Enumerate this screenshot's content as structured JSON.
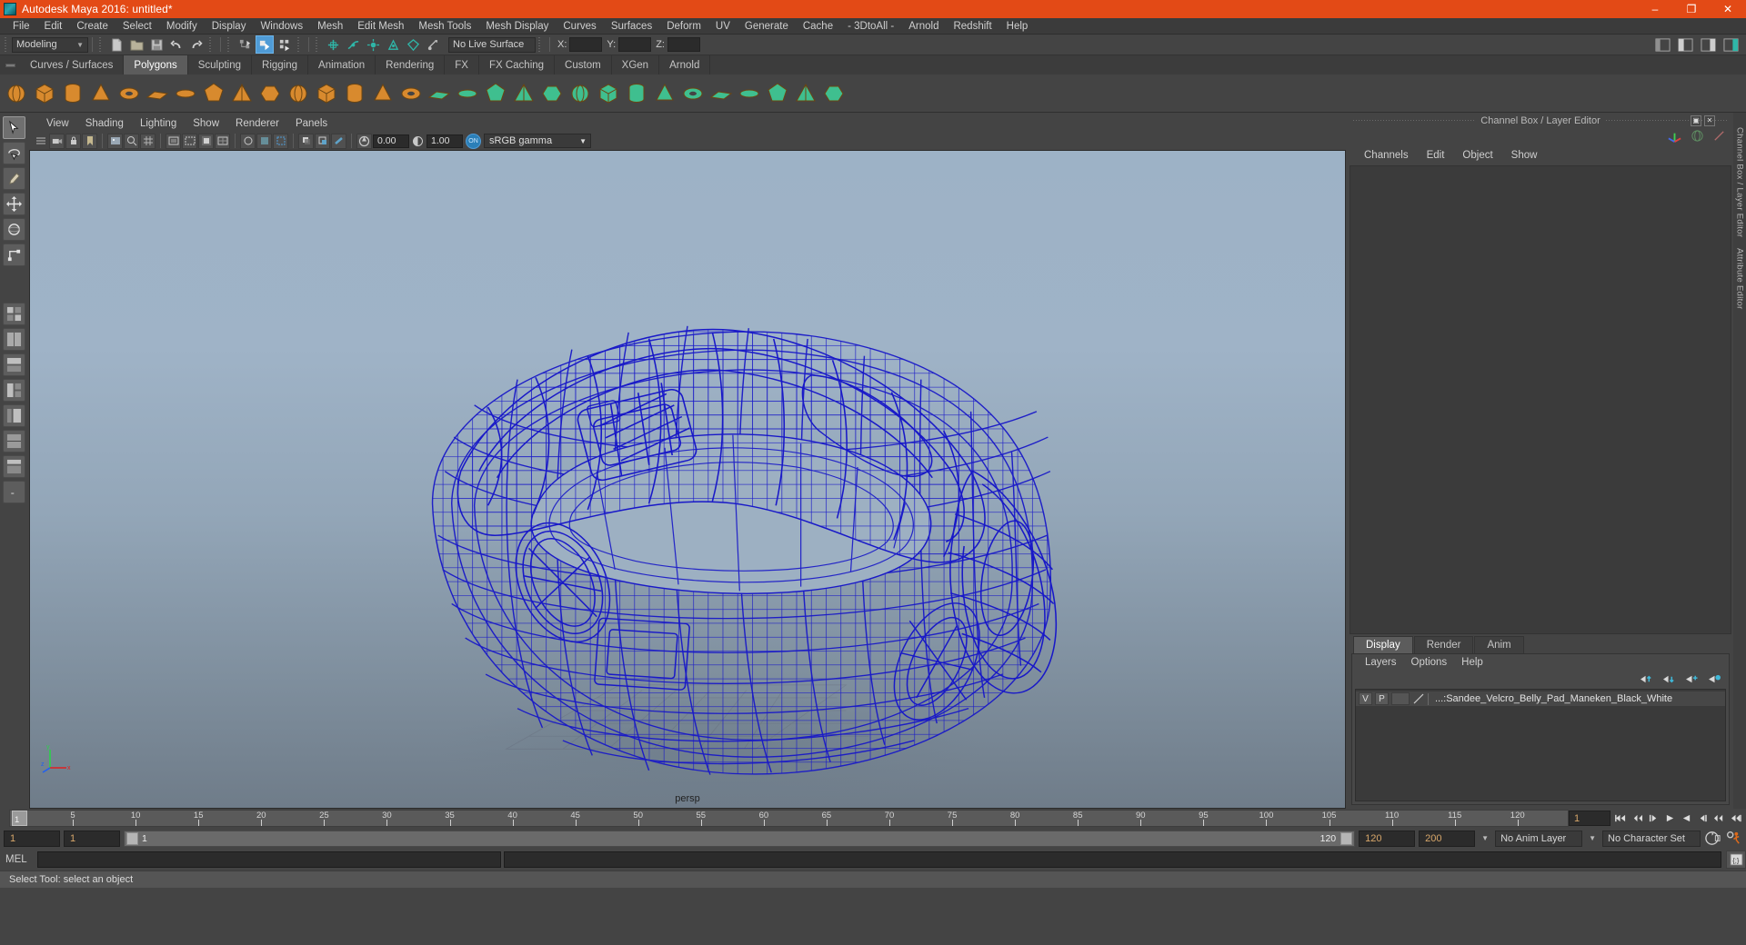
{
  "window": {
    "title": "Autodesk Maya 2016: untitled*",
    "logo_icon": "maya-logo-icon",
    "minimize": "–",
    "maximize": "❐",
    "close": "✕"
  },
  "menubar": {
    "items": [
      "File",
      "Edit",
      "Create",
      "Select",
      "Modify",
      "Display",
      "Windows",
      "Mesh",
      "Edit Mesh",
      "Mesh Tools",
      "Mesh Display",
      "Curves",
      "Surfaces",
      "Deform",
      "UV",
      "Generate",
      "Cache",
      "- 3DtoAll -",
      "Arnold",
      "Redshift",
      "Help"
    ]
  },
  "statusline": {
    "menuset": "Modeling",
    "live_surface": "No Live Surface",
    "coord_labels": [
      "X:",
      "Y:",
      "Z:"
    ],
    "coord_values": [
      "",
      "",
      ""
    ],
    "icons": [
      "new-scene-icon",
      "open-scene-icon",
      "save-scene-icon",
      "undo-icon",
      "redo-icon",
      "select-by-hierarchy-icon",
      "select-by-object-icon",
      "select-by-component-icon",
      "snap-to-grid-icon",
      "snap-to-curve-icon",
      "snap-to-point-icon",
      "snap-to-projected-center-icon",
      "snap-to-view-plane-icon",
      "make-live-icon",
      "show-hide-editors-icon",
      "attribute-editor-toggle-icon",
      "tool-settings-toggle-icon",
      "channel-box-toggle-icon"
    ]
  },
  "shelf": {
    "tabs": [
      "Curves / Surfaces",
      "Polygons",
      "Sculpting",
      "Rigging",
      "Animation",
      "Rendering",
      "FX",
      "FX Caching",
      "Custom",
      "XGen",
      "Arnold"
    ],
    "active_tab": "Polygons",
    "buttons": [
      "poly-sphere-icon",
      "poly-cube-icon",
      "poly-cylinder-icon",
      "poly-cone-icon",
      "poly-torus-icon",
      "poly-plane-icon",
      "poly-disc-icon",
      "poly-platonic-icon",
      "poly-pyramid-icon",
      "poly-prism-icon",
      "poly-pipe-icon",
      "poly-helix-icon",
      "poly-gear-icon",
      "poly-soccer-ball-icon",
      "poly-super-ellipse-icon",
      "sculpt-geometry-icon",
      "poly-combine-icon",
      "poly-separate-icon",
      "poly-booleans-icon",
      "poly-smooth-icon",
      "poly-extrude-icon",
      "poly-bevel-icon",
      "poly-bridge-icon",
      "poly-append-icon",
      "poly-mirror-icon",
      "poly-wedge-icon",
      "poly-reduce-icon",
      "poly-triangulate-icon",
      "poly-quadrangulate-icon",
      "uv-editor-icon"
    ]
  },
  "toolbox": {
    "tools": [
      "select-tool-icon",
      "lasso-select-tool-icon",
      "paint-select-tool-icon",
      "move-tool-icon",
      "rotate-tool-icon",
      "scale-tool-icon",
      "last-tool-icon",
      "layout-four-view-icon",
      "layout-single-icon",
      "layout-two-pane-icon",
      "layout-three-pane-icon",
      "layout-persp-outliner-icon",
      "layout-persp-graph-icon",
      "layout-hypershade-icon",
      "layout-more-icon"
    ],
    "selected": "select-tool-icon"
  },
  "viewport": {
    "menubar": [
      "View",
      "Shading",
      "Lighting",
      "Show",
      "Renderer",
      "Panels"
    ],
    "camera_label": "persp",
    "exposure_value": "0.00",
    "gamma_value": "1.00",
    "color_management_toggle": "ON",
    "color_profile": "sRGB gamma",
    "toolbar_icons": [
      "select-camera-icon",
      "lock-camera-icon",
      "bookmark-icon",
      "image-plane-icon",
      "two-d-pan-zoom-icon",
      "grid-toggle-icon",
      "film-gate-icon",
      "resolution-gate-icon",
      "gate-mask-icon",
      "field-chart-icon",
      "safe-action-icon",
      "safe-title-icon",
      "xray-toggle-icon",
      "xray-joints-icon",
      "shadows-icon",
      "ao-icon",
      "motion-blur-icon",
      "multisample-icon",
      "default-light-icon",
      "all-lights-icon",
      "textured-icon",
      "smooth-shade-icon",
      "flat-shade-icon",
      "wireframe-icon",
      "bounding-box-icon",
      "isolate-select-icon",
      "substitute-geometry-icon",
      "snapshot-icon",
      "exposure-icon",
      "gamma-icon"
    ],
    "object_description": "wireframe belly pad model"
  },
  "channelbox": {
    "panel_title": "Channel Box / Layer Editor",
    "undock_icon": "undock-icon",
    "close_icon": "close-icon",
    "menus": [
      "Channels",
      "Edit",
      "Object",
      "Show"
    ],
    "header_icons": [
      "transform-axis-icon",
      "sphere-icon",
      "slash-icon"
    ],
    "content": ""
  },
  "layereditor": {
    "tabs": [
      "Display",
      "Render",
      "Anim"
    ],
    "active_tab": "Display",
    "menus": [
      "Layers",
      "Options",
      "Help"
    ],
    "toolbar_icons": [
      "move-layer-up-icon",
      "move-layer-down-icon",
      "new-layer-icon",
      "new-layer-from-selected-icon"
    ],
    "layers": [
      {
        "visibility": "V",
        "playback": "P",
        "shading": "",
        "color_swatch": "layer-color-icon",
        "name": "...:Sandee_Velcro_Belly_Pad_Maneken_Black_White"
      }
    ]
  },
  "sidetabs": {
    "labels": [
      "Channel Box / Layer Editor",
      "Attribute Editor"
    ]
  },
  "timeline": {
    "current_frame": "1",
    "tick_labels": [
      "5",
      "10",
      "15",
      "20",
      "25",
      "30",
      "35",
      "40",
      "45",
      "50",
      "55",
      "60",
      "65",
      "70",
      "75",
      "80",
      "85",
      "90",
      "95",
      "100",
      "105",
      "110",
      "115",
      "120"
    ],
    "frame_field": "1",
    "playback_icons": [
      "go-to-start-icon",
      "step-back-frame-icon",
      "step-back-key-icon",
      "play-backwards-icon",
      "play-forwards-icon",
      "step-forward-key-icon",
      "step-forward-frame-icon",
      "go-to-end-icon"
    ]
  },
  "rangeslider": {
    "start_field": "1",
    "range_start_field": "1",
    "range_bar_start": "1",
    "range_bar_end": "120",
    "range_end_field": "120",
    "end_field": "200",
    "anim_layer": "No Anim Layer",
    "character_set": "No Character Set",
    "auto_key_icon": "auto-keyframe-icon",
    "anim_prefs_icon": "animation-preferences-icon"
  },
  "commandline": {
    "label": "MEL",
    "input_value": "",
    "output_value": "",
    "script_editor_icon": "script-editor-icon"
  },
  "helpline": {
    "text": "Select Tool: select an object"
  },
  "colors": {
    "title_bar": "#e34a16",
    "wireframe": "#1818c8",
    "accent_blue": "#4f9bd6",
    "panel_bg": "#444444",
    "field_bg": "#2b2b2b",
    "orange_text": "#d8a76a"
  }
}
